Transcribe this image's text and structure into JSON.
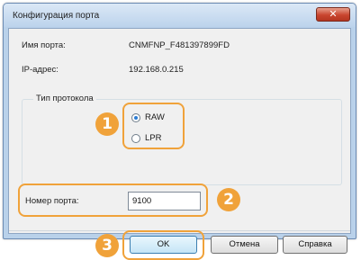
{
  "window": {
    "title": "Конфигурация порта",
    "close_label": "✕"
  },
  "fields": {
    "port_name_label": "Имя порта:",
    "port_name_value": "CNMFNP_F481397899FD",
    "ip_label": "IP-адрес:",
    "ip_value": "192.168.0.215"
  },
  "protocol": {
    "group_title": "Тип протокола",
    "options": [
      {
        "label": "RAW",
        "checked": true
      },
      {
        "label": "LPR",
        "checked": false
      }
    ]
  },
  "port_number": {
    "label": "Номер порта:",
    "value": "9100"
  },
  "buttons": {
    "ok": "OK",
    "cancel": "Отмена",
    "help": "Справка"
  },
  "callouts": [
    "1",
    "2",
    "3"
  ],
  "colors": {
    "callout": "#f0a23a",
    "close": "#c9452f"
  }
}
